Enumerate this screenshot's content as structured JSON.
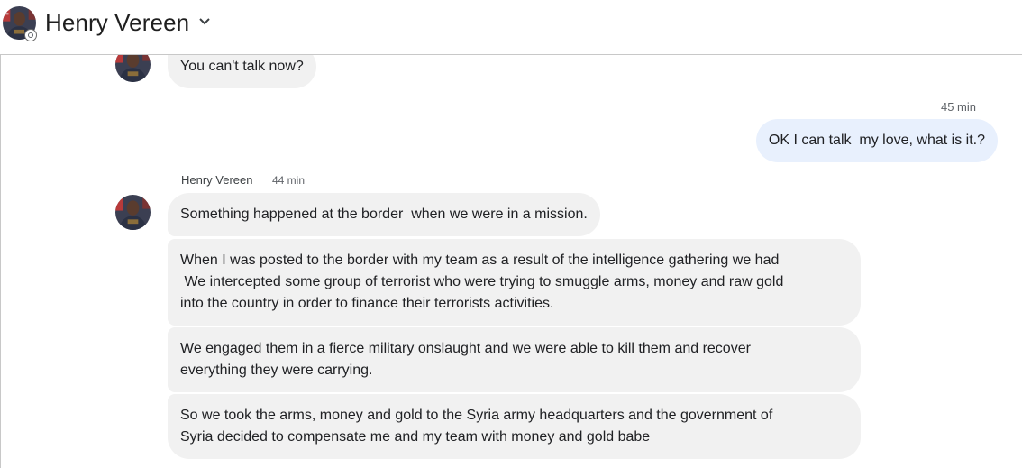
{
  "header": {
    "contact_name": "Henry Vereen"
  },
  "messages": [
    {
      "sender": "contact",
      "text": "You can't talk now?"
    },
    {
      "sender": "me",
      "time": "45 min",
      "text": "OK I can talk  my love, what is it.?"
    },
    {
      "sender": "contact",
      "sender_name": "Henry Vereen",
      "time": "44 min",
      "text": "Something happened at the border  when we were in a mission."
    },
    {
      "sender": "contact",
      "text": "When I was posted to the border with my team as a result of the intelligence gathering we had\n We intercepted some group of terrorist who were trying to smuggle arms, money and raw gold\ninto the country in order to finance their terrorists activities."
    },
    {
      "sender": "contact",
      "text": "We engaged them in a fierce military onslaught and we were able to kill them and recover\neverything they were carrying."
    },
    {
      "sender": "contact",
      "text": "So we took the arms, money and gold to the Syria army headquarters and the government of\nSyria decided to compensate me and my team with money and gold babe"
    }
  ],
  "colors": {
    "incoming_bubble": "#f1f1f1",
    "outgoing_bubble": "#e8f0fd",
    "timestamp": "#5f6368"
  },
  "icons": {
    "chevron": "chevron-down-icon",
    "avatar": "contact-avatar",
    "status": "status-icon"
  }
}
